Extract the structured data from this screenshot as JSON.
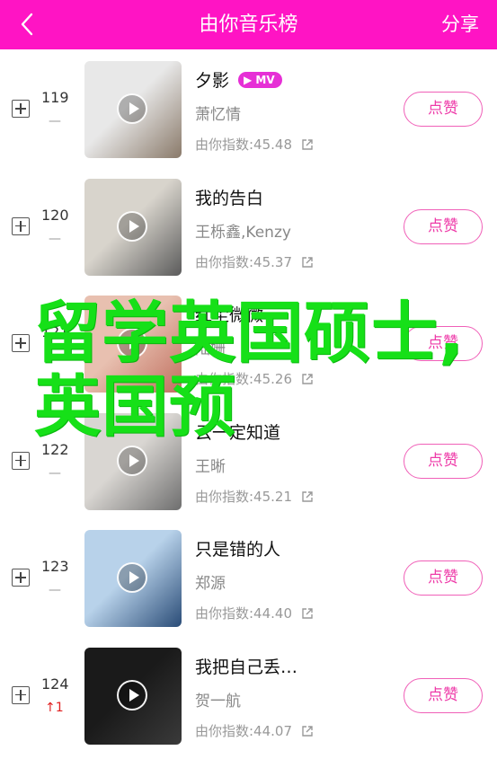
{
  "header": {
    "title": "由你音乐榜",
    "share": "分享",
    "bg_color": "#ff14c4"
  },
  "items": [
    {
      "rank": "119",
      "trend": "—",
      "title": "夕影",
      "mv": "MV",
      "artist": "萧忆情",
      "index": "由你指数:45.48",
      "like": "点赞",
      "cover_colors": [
        "#e8e8e8",
        "#8a7a6a"
      ]
    },
    {
      "rank": "120",
      "trend": "—",
      "title": "我的告白",
      "mv": "",
      "artist": "王栎鑫,Kenzy",
      "index": "由你指数:45.37",
      "like": "点赞",
      "cover_colors": [
        "#d8d4cc",
        "#5b5b5b"
      ]
    },
    {
      "rank": "121",
      "trend": "—",
      "title": "红尘微微",
      "mv": "",
      "artist": "陆姗",
      "index": "由你指数:45.26",
      "like": "点赞",
      "cover_colors": [
        "#e8c0b0",
        "#c07060"
      ]
    },
    {
      "rank": "122",
      "trend": "—",
      "title": "云一定知道",
      "mv": "",
      "artist": "王晰",
      "index": "由你指数:45.21",
      "like": "点赞",
      "cover_colors": [
        "#d9d6d2",
        "#6e6e6e"
      ]
    },
    {
      "rank": "123",
      "trend": "—",
      "title": "只是错的人",
      "mv": "",
      "artist": "郑源",
      "index": "由你指数:44.40",
      "like": "点赞",
      "cover_colors": [
        "#b8d2ea",
        "#2a4c77"
      ]
    },
    {
      "rank": "124",
      "trend": "↑1",
      "title": "我把自己丢…",
      "mv": "",
      "artist": "贺一航",
      "index": "由你指数:44.07",
      "like": "点赞",
      "cover_colors": [
        "#1a1a1a",
        "#3a3a3a"
      ]
    }
  ],
  "overlay_text": "留学英国硕士,英国预"
}
